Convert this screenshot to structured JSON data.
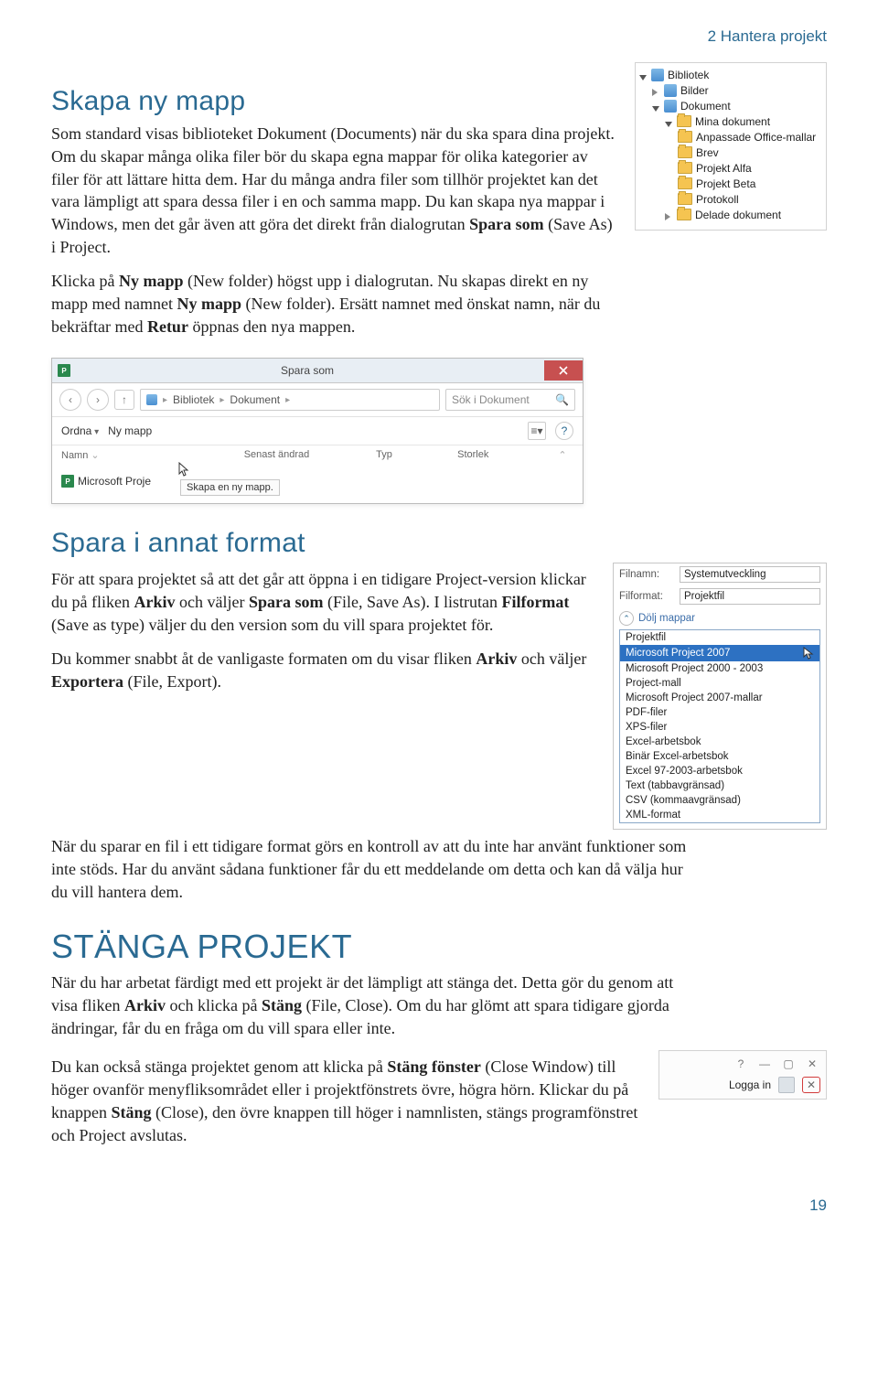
{
  "chapter": "2  Hantera projekt",
  "page_number": "19",
  "s1": {
    "heading": "Skapa ny mapp",
    "p1_a": "Som standard visas biblioteket Dokument (Documents) när du ska spara dina projekt. Om du skapar många olika filer bör du skapa egna mappar för olika kategorier av filer för att lättare hitta dem. Har du många andra filer som tillhör projektet kan det vara lämpligt att spara dessa filer i en och samma mapp. Du kan skapa nya mappar i Windows, men det går även att göra det direkt från dialogrutan ",
    "p1_b": "Spara som",
    "p1_c": " (Save As) i Project.",
    "p2_a": "Klicka på ",
    "p2_b": "Ny mapp",
    "p2_c": " (New folder) högst upp i dialogrutan. Nu skapas direkt en ny mapp med namnet ",
    "p2_d": "Ny mapp",
    "p2_e": " (New folder). Ersätt namnet med önskat namn, när du bekräftar med ",
    "p2_f": "Retur",
    "p2_g": " öppnas den nya mappen."
  },
  "tree": {
    "root": "Bibliotek",
    "items": [
      {
        "l": "Bilder",
        "d": 1
      },
      {
        "l": "Dokument",
        "d": 1,
        "open": true
      },
      {
        "l": "Mina dokument",
        "d": 2,
        "open": true
      },
      {
        "l": "Anpassade Office-mallar",
        "d": 3
      },
      {
        "l": "Brev",
        "d": 3
      },
      {
        "l": "Projekt Alfa",
        "d": 3
      },
      {
        "l": "Projekt Beta",
        "d": 3
      },
      {
        "l": "Protokoll",
        "d": 3
      },
      {
        "l": "Delade dokument",
        "d": 2
      }
    ]
  },
  "dlg": {
    "title": "Spara som",
    "breadcrumb": [
      "Bibliotek",
      "Dokument"
    ],
    "search_placeholder": "Sök i Dokument",
    "ordna": "Ordna",
    "ny_mapp": "Ny mapp",
    "tooltip": "Skapa en ny mapp.",
    "cols": [
      "Namn",
      "Senast ändrad",
      "Typ",
      "Storlek"
    ],
    "side_label": "Microsoft Proje"
  },
  "s2": {
    "heading": "Spara i annat format",
    "p1_a": "För att spara projektet så att det går att öppna i en tidigare Project-version klickar du på fliken ",
    "p1_b": "Arkiv",
    "p1_c": " och väljer ",
    "p1_d": "Spara som",
    "p1_e": " (File, Save As). I listrutan ",
    "p1_f": "Filformat",
    "p1_g": " (Save as type) väljer du den version som du vill spara projektet för.",
    "p2_a": "Du kommer snabbt åt de vanligaste formaten om du visar fliken ",
    "p2_b": "Arkiv",
    "p2_c": " och väljer ",
    "p2_d": "Exportera",
    "p2_e": " (File, Export).",
    "p3": "När du sparar en fil i ett tidigare format görs en kontroll av att du inte har använt funktioner som inte stöds. Har du använt sådana funktioner får du ett meddelande om detta och kan då välja hur du vill hantera dem."
  },
  "fmt": {
    "filnamn_lbl": "Filnamn:",
    "filnamn_val": "Systemutveckling",
    "filformat_lbl": "Filformat:",
    "filformat_val": "Projektfil",
    "hide": "Dölj mappar",
    "options": [
      "Projektfil",
      "Microsoft Project 2007",
      "Microsoft Project 2000 - 2003",
      "Project-mall",
      "Microsoft Project 2007-mallar",
      "PDF-filer",
      "XPS-filer",
      "Excel-arbetsbok",
      "Binär Excel-arbetsbok",
      "Excel 97-2003-arbetsbok",
      "Text (tabbavgränsad)",
      "CSV (kommaavgränsad)",
      "XML-format"
    ],
    "selected": "Microsoft Project 2007"
  },
  "s3": {
    "heading": "STÄNGA PROJEKT",
    "p1_a": "När du har arbetat färdigt med ett projekt är det lämpligt att stänga det. Detta gör du genom att visa fliken ",
    "p1_b": "Arkiv",
    "p1_c": " och klicka på ",
    "p1_d": "Stäng",
    "p1_e": " (File, Close). Om du har glömt att spara tidigare gjorda ändringar, får du en fråga om du vill spara eller inte.",
    "p2_a": "Du kan också stänga projektet genom att klicka på ",
    "p2_b": "Stäng fönster",
    "p2_c": " (Close Window) till höger ovanför menyfliksområdet eller i projektfönstrets övre, högra hörn. Klickar du på knappen ",
    "p2_d": "Stäng",
    "p2_e": " (Close), den övre knappen till höger i namnlisten, stängs programfönstret och Project avslutas."
  },
  "winc": {
    "signin": "Logga in"
  }
}
